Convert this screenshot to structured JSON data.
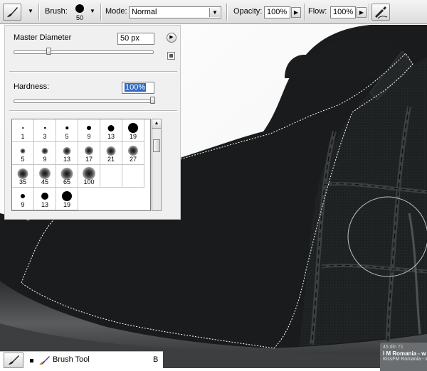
{
  "options_bar": {
    "brush_label": "Brush:",
    "brush_size": "50",
    "mode_label": "Mode:",
    "mode_value": "Normal",
    "opacity_label": "Opacity:",
    "opacity_value": "100%",
    "flow_label": "Flow:",
    "flow_value": "100%",
    "icons": [
      "brush-preset-icon",
      "airbrush-icon"
    ]
  },
  "brush_panel": {
    "master_diameter_label": "Master Diameter",
    "master_diameter_value": "50 px",
    "master_diameter_slider": 0.25,
    "hardness_label": "Hardness:",
    "hardness_value": "100%",
    "hardness_slider": 1.0,
    "presets": [
      {
        "label": "1",
        "d": 1.5,
        "soft": false
      },
      {
        "label": "3",
        "d": 2.5,
        "soft": false
      },
      {
        "label": "5",
        "d": 3.5,
        "soft": false
      },
      {
        "label": "9",
        "d": 6,
        "soft": false
      },
      {
        "label": "13",
        "d": 9,
        "soft": false
      },
      {
        "label": "19",
        "d": 14,
        "soft": false
      },
      {
        "label": "5",
        "d": 3,
        "soft": true
      },
      {
        "label": "9",
        "d": 5,
        "soft": true
      },
      {
        "label": "13",
        "d": 7,
        "soft": true
      },
      {
        "label": "17",
        "d": 8,
        "soft": true
      },
      {
        "label": "21",
        "d": 9,
        "soft": true
      },
      {
        "label": "27",
        "d": 10,
        "soft": true
      },
      {
        "label": "35",
        "d": 11,
        "soft": true
      },
      {
        "label": "45",
        "d": 12,
        "soft": true
      },
      {
        "label": "65",
        "d": 13,
        "soft": true
      },
      {
        "label": "100",
        "d": 14,
        "soft": true
      },
      {
        "label": "",
        "d": 0,
        "soft": true
      },
      {
        "label": "",
        "d": 0,
        "soft": true
      },
      {
        "label": "9",
        "d": 6,
        "soft": false
      },
      {
        "label": "13",
        "d": 10,
        "soft": false
      },
      {
        "label": "19",
        "d": 14,
        "soft": false
      }
    ]
  },
  "tool_strip": {
    "tool_name": "Brush Tool",
    "shortcut": "B"
  },
  "notification": {
    "line1": "45 din 71",
    "line2": "I M Romania - w",
    "line3": "KissFM Romania - w"
  }
}
